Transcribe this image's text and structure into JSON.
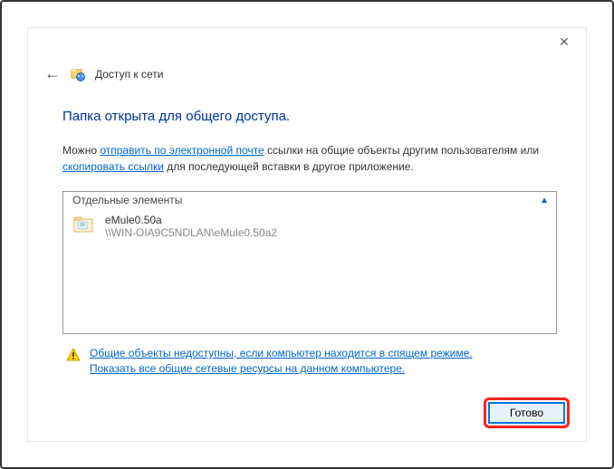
{
  "titlebar": {
    "close_symbol": "✕"
  },
  "header": {
    "back_symbol": "←",
    "title": "Доступ к сети"
  },
  "content": {
    "heading": "Папка открыта для общего доступа.",
    "desc_prefix": "Можно ",
    "link_email": "отправить по электронной почте",
    "desc_mid": " ссылки на общие объекты другим пользователям или ",
    "link_copy": "скопировать ссылки",
    "desc_suffix": " для последующей вставки в другое приложение."
  },
  "items_box": {
    "header_label": "Отдельные элементы",
    "chevron": "▲",
    "item": {
      "name": "eMule0.50a",
      "path": "\\\\WIN-OIA9C5NDLAN\\eMule0.50a2"
    }
  },
  "warning": {
    "link1": "Общие объекты недоступны, если компьютер находится в спящем режиме.",
    "link2": "Показать все общие сетевые ресурсы на данном компьютере."
  },
  "footer": {
    "done_label": "Готово"
  }
}
